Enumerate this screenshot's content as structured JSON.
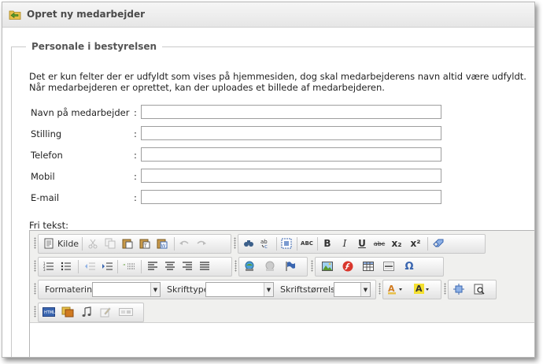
{
  "window": {
    "title": "Opret ny medarbejder"
  },
  "fieldset": {
    "legend": "Personale i bestyrelsen",
    "info_line1": "Det er kun felter der er udfyldt som vises på hjemmesiden, dog skal medarbejderens navn altid være udfyldt.",
    "info_line2": "Når medarbejderen er oprettet, kan der uploades et billede af medarbejderen."
  },
  "form": {
    "colon": ":",
    "fields": [
      {
        "label": "Navn på medarbejder",
        "value": ""
      },
      {
        "label": "Stilling",
        "value": ""
      },
      {
        "label": "Telefon",
        "value": ""
      },
      {
        "label": "Mobil",
        "value": ""
      },
      {
        "label": "E-mail",
        "value": ""
      }
    ]
  },
  "editor": {
    "label": "Fri tekst:",
    "source_label": "Kilde",
    "format_label": "Formatering",
    "font_label": "Skrifttype",
    "size_label": "Skriftstørrelse",
    "format_value": "",
    "font_value": "",
    "size_value": "",
    "content": ""
  },
  "icons": {
    "italic": "I",
    "bold": "B",
    "underline": "U",
    "strike": "abc",
    "subscript": "x₂",
    "superscript": "x²",
    "omega": "Ω",
    "spell": "ABC"
  },
  "colors": {
    "accent_green": "#5a9a2e",
    "folder_yellow": "#e8c04a",
    "flash_red": "#d9362c",
    "link_blue": "#3a66b0"
  }
}
